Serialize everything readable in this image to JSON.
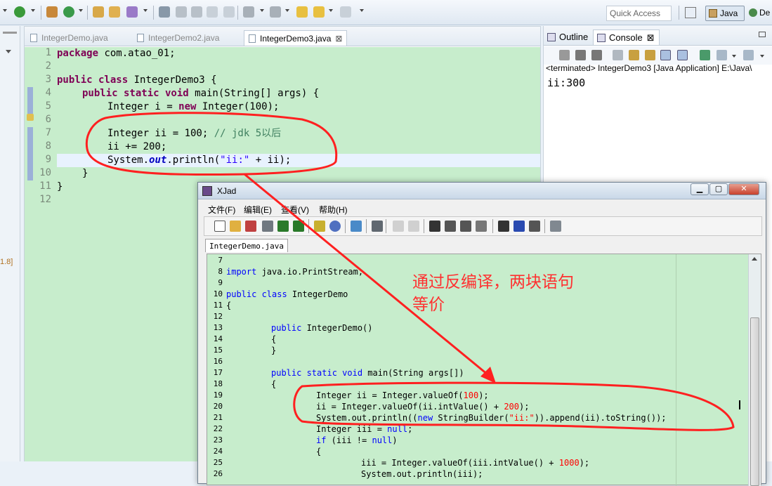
{
  "toolbar": {
    "quick_access": "Quick Access",
    "perspective_java": "Java",
    "perspective_debug": "De"
  },
  "left_strip": {
    "label": "1.8]"
  },
  "editor": {
    "tabs": [
      {
        "label": "IntegerDemo.java",
        "active": false
      },
      {
        "label": "IntegerDemo2.java",
        "active": false
      },
      {
        "label": "IntegerDemo3.java",
        "active": true,
        "close": "⊠"
      }
    ],
    "line_numbers": [
      "1",
      "2",
      "3",
      "4",
      "5",
      "6",
      "7",
      "8",
      "9",
      "10",
      "11",
      "12"
    ],
    "code": {
      "l1_kw": "package",
      "l1_rest": " com.atao_01;",
      "l3_kw": "public class",
      "l3_rest": " IntegerDemo3 {",
      "l4_kw": "public static void",
      "l4_rest": " main(String[] args) {",
      "l5_a": "Integer i = ",
      "l5_kw": "new",
      "l5_b": " Integer(100);",
      "l7_a": "Integer ii = 100; ",
      "l7_cm": "// jdk 5以后",
      "l8": "ii += 200;",
      "l9_a": "System.",
      "l9_fi": "out",
      "l9_b": ".println(",
      "l9_st": "\"ii:\"",
      "l9_c": " + ii);",
      "l10": "}",
      "l11": "}"
    }
  },
  "right_panel": {
    "tabs": [
      {
        "label": "Outline",
        "active": false
      },
      {
        "label": "Console",
        "active": true,
        "close": "⊠"
      }
    ],
    "terminated": "<terminated> IntegerDemo3 [Java Application] E:\\Java\\",
    "output": "ii:300"
  },
  "xjad": {
    "title": "XJad",
    "menu": [
      "文件(F)",
      "编辑(E)",
      "查看(V)",
      "帮助(H)"
    ],
    "tab": "IntegerDemo.java",
    "line_numbers": [
      "7",
      "8",
      "9",
      "10",
      "11",
      "12",
      "13",
      "14",
      "15",
      "16",
      "17",
      "18",
      "19",
      "20",
      "21",
      "22",
      "23",
      "24",
      "25",
      "26"
    ],
    "code": {
      "l8_kw": "import",
      "l8_rest": " java.io.PrintStream;",
      "l10_kw": "public class",
      "l10_rest": " IntegerDemo",
      "l11": "{",
      "l13_kw": "public",
      "l13_rest": " IntegerDemo()",
      "l14": "{",
      "l15": "}",
      "l17_kw": "public static void",
      "l17_rest": " main(String args[])",
      "l18": "{",
      "l19_a": "Integer ii = Integer.valueOf(",
      "l19_n": "100",
      "l19_b": ");",
      "l20_a": "ii = Integer.valueOf(ii.intValue() + ",
      "l20_n": "200",
      "l20_b": ");",
      "l21_a": "System.out.println((",
      "l21_kw": "new",
      "l21_b": " StringBuilder(",
      "l21_st": "\"ii:\"",
      "l21_c": ")).append(ii).toString());",
      "l22_a": "Integer iii = ",
      "l22_kw": "null",
      "l22_b": ";",
      "l23_kw": "if",
      "l23_a": " (iii != ",
      "l23_kw2": "null",
      "l23_b": ")",
      "l24": "{",
      "l25_a": "iii = Integer.valueOf(iii.intValue() + ",
      "l25_n": "1000",
      "l25_b": ");",
      "l26": "System.out.println(iii);"
    }
  },
  "annotation": {
    "line1": "通过反编译，两块语句",
    "line2": "等价",
    "color": "#ff3030"
  }
}
